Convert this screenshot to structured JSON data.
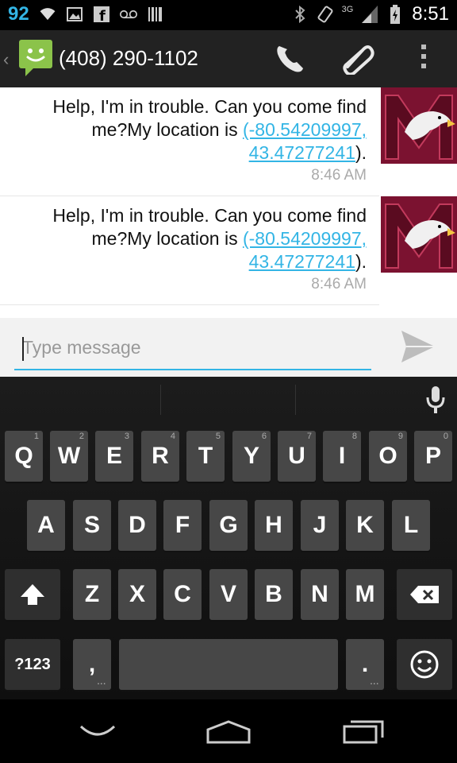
{
  "statusbar": {
    "battery_pct": "92",
    "network": "3G",
    "time": "8:51"
  },
  "actionbar": {
    "title": "(408) 290-1102"
  },
  "messages": [
    {
      "text_prefix": "Help, I'm in trouble. Can you come find me?My location is ",
      "link1": "(-80.54209997,",
      "link2": "43.47277241",
      "text_suffix": ").",
      "time": "8:46 AM"
    },
    {
      "text_prefix": "Help, I'm in trouble. Can you come find me?My location is ",
      "link1": "(-80.54209997,",
      "link2": "43.47277241",
      "text_suffix": ").",
      "time": "8:46 AM"
    }
  ],
  "compose": {
    "placeholder": "Type message"
  },
  "keyboard": {
    "row1": [
      {
        "label": "Q",
        "num": "1"
      },
      {
        "label": "W",
        "num": "2"
      },
      {
        "label": "E",
        "num": "3"
      },
      {
        "label": "R",
        "num": "4"
      },
      {
        "label": "T",
        "num": "5"
      },
      {
        "label": "Y",
        "num": "6"
      },
      {
        "label": "U",
        "num": "7"
      },
      {
        "label": "I",
        "num": "8"
      },
      {
        "label": "O",
        "num": "9"
      },
      {
        "label": "P",
        "num": "0"
      }
    ],
    "row2": [
      "A",
      "S",
      "D",
      "F",
      "G",
      "H",
      "J",
      "K",
      "L"
    ],
    "row3": [
      "Z",
      "X",
      "C",
      "V",
      "B",
      "N",
      "M"
    ],
    "symbols_label": "?123",
    "comma_label": ",",
    "period_label": "."
  },
  "colors": {
    "accent": "#33b5e5",
    "key": "#474747",
    "message_logo_green": "#8bc34a",
    "avatar_maroon": "#7b1230"
  }
}
